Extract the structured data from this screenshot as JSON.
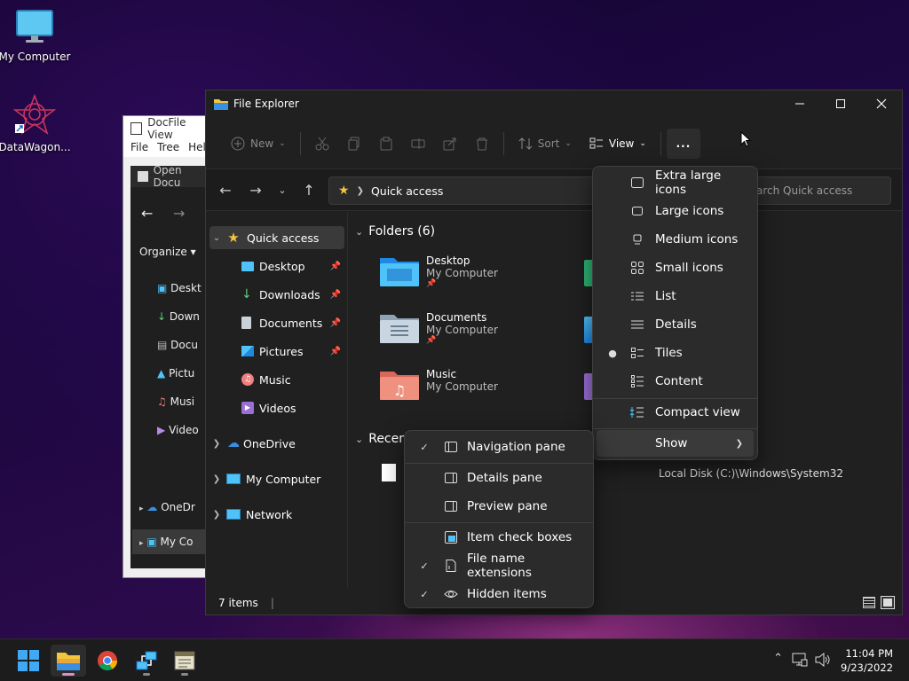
{
  "desktop": {
    "icons": [
      {
        "label": "My Computer"
      },
      {
        "label": "DataWagon..."
      }
    ]
  },
  "docfile_window": {
    "title": "DocFile View",
    "menu": [
      "File",
      "Tree",
      "Hel"
    ],
    "inner_title": "Open Docu",
    "organize": "Organize",
    "items": [
      "Deskt",
      "Down",
      "Docu",
      "Pictu",
      "Musi",
      "Video",
      "OneDr",
      "My Co"
    ]
  },
  "explorer": {
    "title": "File Explorer",
    "toolbar": {
      "new_label": "New",
      "sort_label": "Sort",
      "view_label": "View",
      "more_label": "..."
    },
    "address": {
      "location": "Quick access",
      "search_placeholder": "Search Quick access"
    },
    "sidebar": {
      "quick_access": "Quick access",
      "pinned": [
        "Desktop",
        "Downloads",
        "Documents",
        "Pictures"
      ],
      "unpinned": [
        "Music",
        "Videos"
      ],
      "onedrive": "OneDrive",
      "my_computer": "My Computer",
      "network": "Network"
    },
    "folders_header": "Folders (6)",
    "folders": [
      {
        "name": "Desktop",
        "location": "My Computer"
      },
      {
        "name": "Documents",
        "location": "My Computer"
      },
      {
        "name": "Music",
        "location": "My Computer"
      }
    ],
    "recent_header": "Recen",
    "recent_path": "Local Disk (C:)\\Windows\\System32",
    "status": "7 items"
  },
  "view_menu": {
    "items": [
      "Extra large icons",
      "Large icons",
      "Medium icons",
      "Small icons",
      "List",
      "Details",
      "Tiles",
      "Content"
    ],
    "selected": "Tiles",
    "compact": "Compact view",
    "show": "Show"
  },
  "show_menu": {
    "items": [
      {
        "label": "Navigation pane",
        "checked": true
      },
      {
        "label": "Details pane",
        "checked": false
      },
      {
        "label": "Preview pane",
        "checked": false
      },
      {
        "label": "Item check boxes",
        "checked": false
      },
      {
        "label": "File name extensions",
        "checked": true
      },
      {
        "label": "Hidden items",
        "checked": true
      }
    ]
  },
  "taskbar": {
    "time": "11:04 PM",
    "date": "9/23/2022"
  },
  "colors": {
    "folder_yellow": "#f3c53c",
    "accent_blue": "#4fc3f7",
    "active_indicator": "#d88fd0"
  }
}
